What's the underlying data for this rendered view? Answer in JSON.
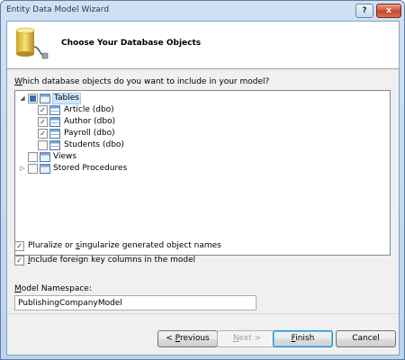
{
  "window": {
    "title": "Entity Data Model Wizard",
    "help_label": "?",
    "close_label": "x"
  },
  "header": {
    "title": "Choose Your Database Objects",
    "icon": "database-plug-icon"
  },
  "question": {
    "accel": "W",
    "rest": "hich database objects do you want to include in your model?"
  },
  "tree": {
    "tables": {
      "label": "Tables",
      "expanded": true,
      "state": "partial"
    },
    "table_items": [
      {
        "label": "Article (dbo)",
        "checked": true
      },
      {
        "label": "Author (dbo)",
        "checked": true
      },
      {
        "label": "Payroll (dbo)",
        "checked": true
      },
      {
        "label": "Students (dbo)",
        "checked": false
      }
    ],
    "views": {
      "label": "Views",
      "checked": false
    },
    "procs": {
      "label": "Stored Procedures",
      "checked": false
    }
  },
  "options": {
    "pluralize": {
      "pre": "Pluralize or ",
      "accel": "s",
      "post": "ingularize generated object names",
      "checked": true
    },
    "foreign_keys": {
      "pre": "",
      "accel": "I",
      "post": "nclude foreign key columns in the model",
      "checked": true
    }
  },
  "namespace": {
    "label_accel": "M",
    "label_rest": "odel Namespace:",
    "value": "PublishingCompanyModel"
  },
  "buttons": {
    "previous": {
      "pre": "< ",
      "accel": "P",
      "post": "revious"
    },
    "next": {
      "pre": "",
      "accel": "N",
      "post": "ext >"
    },
    "finish": {
      "pre": "",
      "accel": "F",
      "post": "inish"
    },
    "cancel": {
      "label": "Cancel"
    }
  },
  "colors": {
    "accent": "#1e395b",
    "selection": "#cde8ff",
    "check": "#1c3a6e"
  }
}
